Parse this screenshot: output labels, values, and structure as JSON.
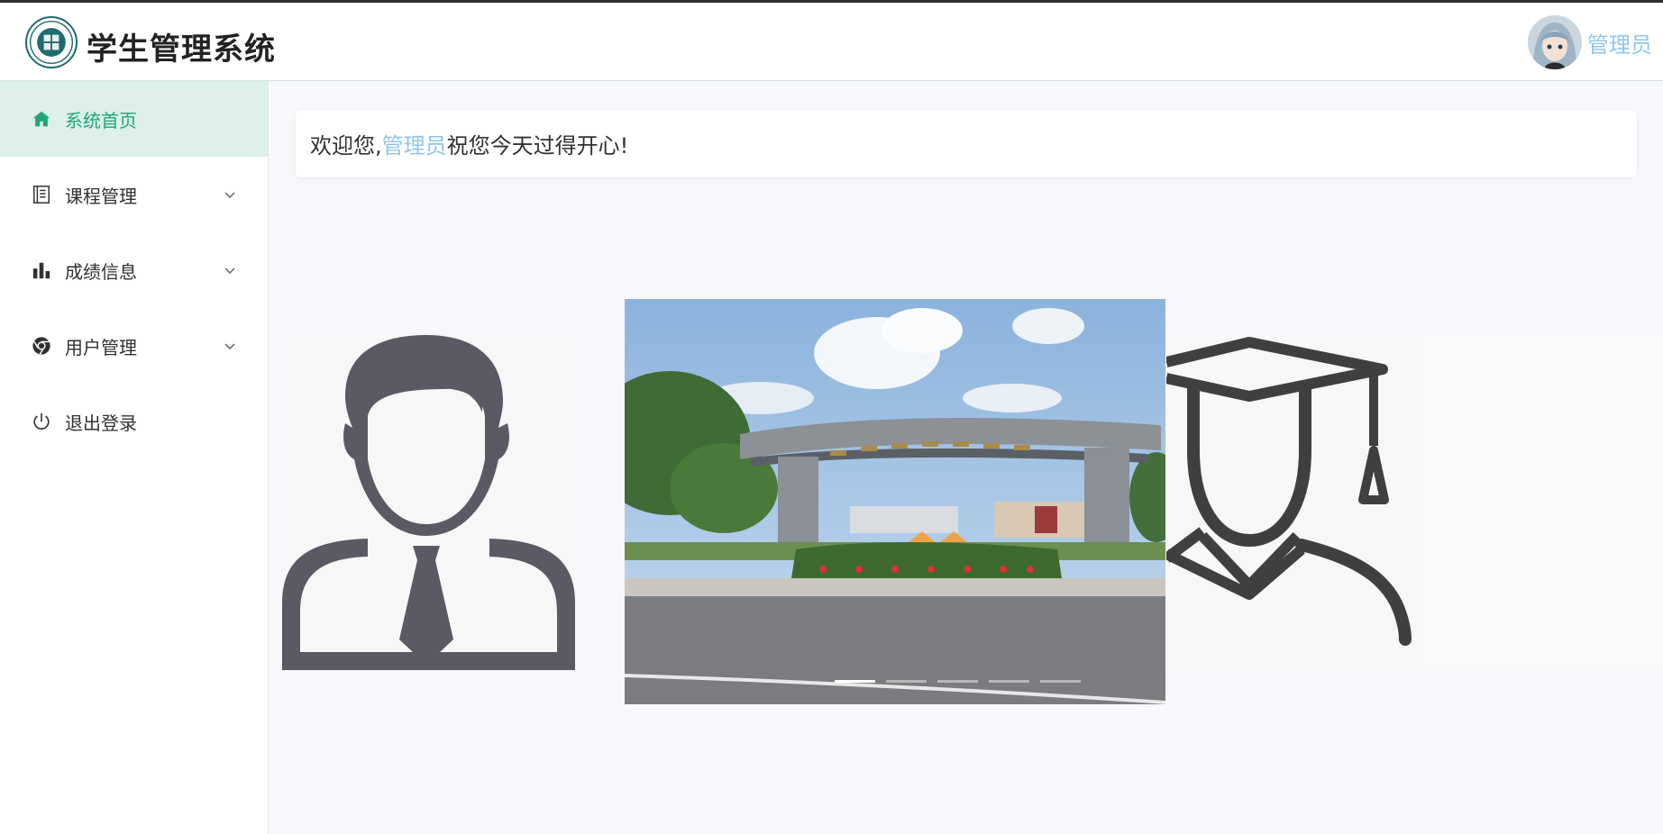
{
  "header": {
    "title": "学生管理系统",
    "logo_icon": "school-seal-icon",
    "user_name": "管理员",
    "avatar_icon": "anime-avatar-icon"
  },
  "sidebar": {
    "items": [
      {
        "label": "系统首页",
        "icon": "home-icon",
        "active": true
      },
      {
        "label": "课程管理",
        "icon": "notebook-icon",
        "expandable": true
      },
      {
        "label": "成绩信息",
        "icon": "bar-chart-icon",
        "expandable": true
      },
      {
        "label": "用户管理",
        "icon": "chrome-icon",
        "expandable": true
      },
      {
        "label": "退出登录",
        "icon": "power-icon"
      }
    ]
  },
  "welcome": {
    "prefix": "欢迎您,",
    "name": "管理员",
    "suffix": " 祝您今天过得开心!"
  },
  "carousel": {
    "slides": [
      {
        "icon": "teacher-icon"
      },
      {
        "icon": "campus-gate-photo"
      },
      {
        "icon": "graduate-icon"
      }
    ],
    "indicator_count": 5,
    "active_index": 0
  },
  "colors": {
    "accent": "#21a67a",
    "active_bg": "#dcefe9",
    "highlight": "#8fc6ea",
    "teacher_icon": "#5a5964",
    "graduate_icon": "#3f3f3f"
  }
}
